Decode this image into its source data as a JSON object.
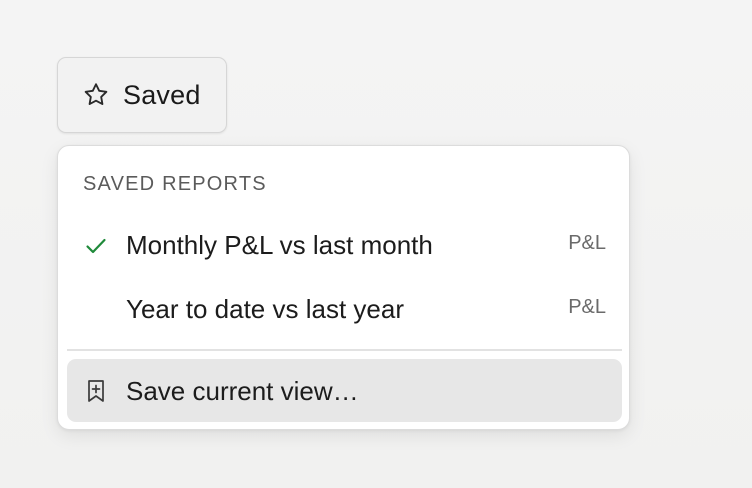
{
  "saved_button": {
    "icon": "star-outline-icon",
    "label": "Saved"
  },
  "menu": {
    "heading": "SAVED REPORTS",
    "items": [
      {
        "label": "Monthly P&L vs last month",
        "tag": "P&L",
        "selected": true,
        "icon": "checkmark-icon"
      },
      {
        "label": "Year to date vs last year",
        "tag": "P&L",
        "selected": false
      }
    ],
    "action": {
      "icon": "bookmark-plus-icon",
      "label": "Save current view…"
    }
  },
  "colors": {
    "background": "#f3f3f3",
    "menu_background": "#ffffff",
    "hover_background": "#e7e7e7",
    "check_green": "#1f8a3a",
    "muted_text": "#6a6a6a"
  }
}
